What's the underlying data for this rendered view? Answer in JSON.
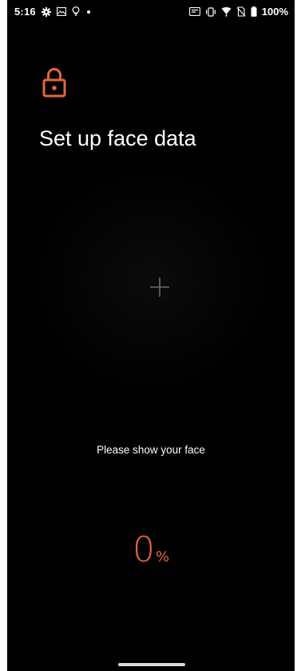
{
  "status_bar": {
    "time": "5:16",
    "battery_text": "100%",
    "left_icons": [
      "gear-icon",
      "image-icon",
      "lightbulb-icon",
      "dot-icon"
    ],
    "right_icons": [
      "nfc-icon",
      "vibrate-icon",
      "wifi-icon",
      "no-sim-icon",
      "battery-icon"
    ]
  },
  "header": {
    "icon": "lock-icon",
    "title": "Set up face data"
  },
  "camera": {
    "icon": "crosshair-icon"
  },
  "instruction": "Please show your face",
  "progress": {
    "value": "0",
    "unit": "%"
  },
  "colors": {
    "background": "#000000",
    "accent": "#e8663d",
    "text": "#ffffff"
  }
}
